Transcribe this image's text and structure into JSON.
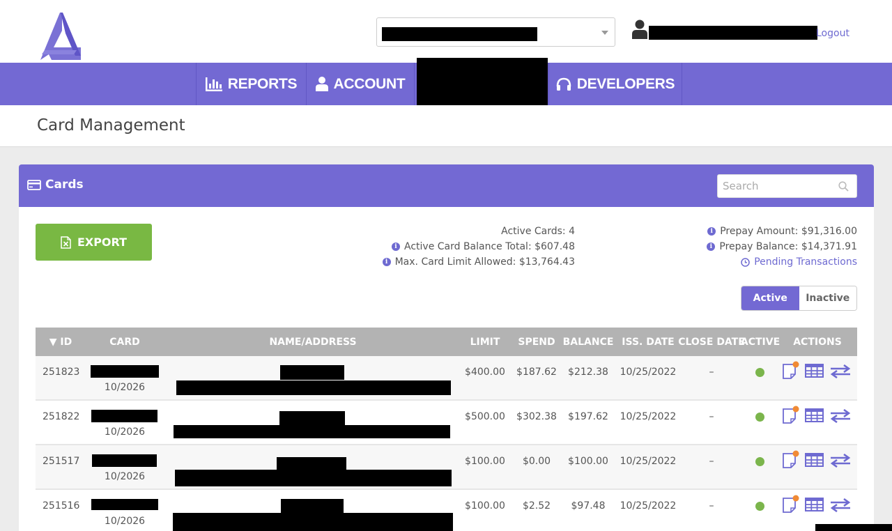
{
  "header": {
    "logout_label": "Logout"
  },
  "nav": {
    "items": [
      {
        "label": "REPORTS",
        "icon": "bar-chart-icon"
      },
      {
        "label": "ACCOUNT",
        "icon": "user-icon"
      },
      {
        "label": "",
        "icon": ""
      },
      {
        "label": "DEVELOPERS",
        "icon": "headset-icon"
      }
    ]
  },
  "page": {
    "title": "Card Management"
  },
  "panel": {
    "title": "Cards",
    "search_placeholder": "Search",
    "export_label": "EXPORT"
  },
  "stats": {
    "active_cards": "Active Cards: 4",
    "active_balance_total": "Active Card Balance Total: $607.48",
    "max_card_limit": "Max. Card Limit Allowed: $13,764.43",
    "prepay_amount": "Prepay Amount: $91,316.00",
    "prepay_balance": "Prepay Balance: $14,371.91",
    "pending_transactions": "Pending Transactions"
  },
  "toggle": {
    "active": "Active",
    "inactive": "Inactive",
    "selected": "Active"
  },
  "table": {
    "columns": [
      "▼ ID",
      "CARD",
      "NAME/ADDRESS",
      "LIMIT",
      "SPEND",
      "BALANCE",
      "ISS. DATE",
      "CLOSE DATE",
      "ACTIVE",
      "ACTIONS"
    ],
    "rows": [
      {
        "id": "251823",
        "expiry": "10/2026",
        "limit": "$400.00",
        "spend": "$187.62",
        "balance": "$212.38",
        "iss_date": "10/25/2022",
        "close_date": "–",
        "active": true
      },
      {
        "id": "251822",
        "expiry": "10/2026",
        "limit": "$500.00",
        "spend": "$302.38",
        "balance": "$197.62",
        "iss_date": "10/25/2022",
        "close_date": "–",
        "active": true
      },
      {
        "id": "251517",
        "expiry": "10/2026",
        "limit": "$100.00",
        "spend": "$0.00",
        "balance": "$100.00",
        "iss_date": "10/25/2022",
        "close_date": "–",
        "active": true
      },
      {
        "id": "251516",
        "expiry": "10/2026",
        "limit": "$100.00",
        "spend": "$2.52",
        "balance": "$97.48",
        "iss_date": "10/25/2022",
        "close_date": "–",
        "active": true
      }
    ]
  },
  "colors": {
    "brand_purple": "#7369d3",
    "export_green": "#79b843",
    "active_dot": "#7bb54c",
    "notification_orange": "#f08a35"
  }
}
